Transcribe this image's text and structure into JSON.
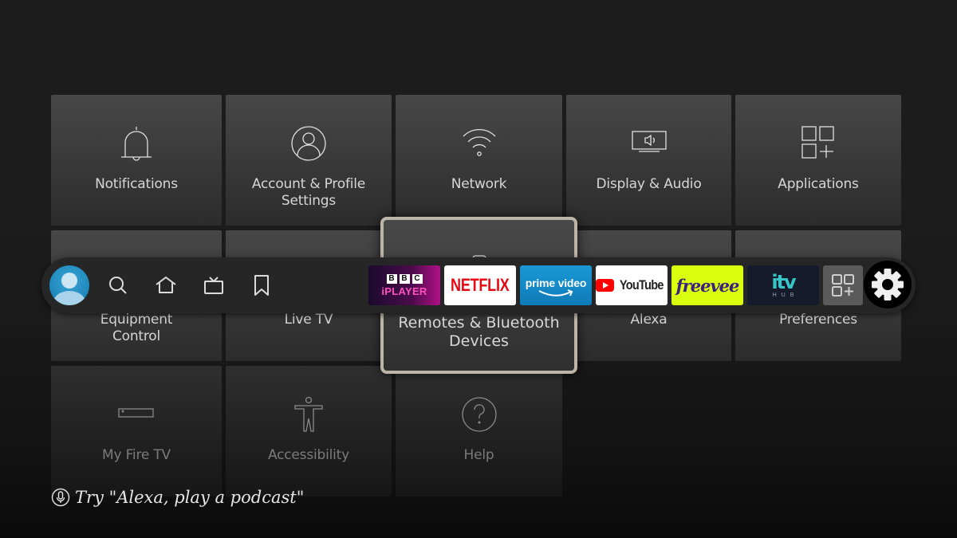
{
  "settings_grid": {
    "tiles": [
      {
        "label": "Notifications",
        "icon": "bell-icon"
      },
      {
        "label": "Account & Profile Settings",
        "icon": "profile-icon"
      },
      {
        "label": "Network",
        "icon": "wifi-icon"
      },
      {
        "label": "Display & Audio",
        "icon": "display-audio-icon"
      },
      {
        "label": "Applications",
        "icon": "applications-icon"
      },
      {
        "label": "Equipment Control",
        "icon": "equipment-icon"
      },
      {
        "label": "Live TV",
        "icon": "live-tv-icon"
      },
      {
        "label": "Remotes & Bluetooth Devices",
        "icon": "remote-icon",
        "focused": true
      },
      {
        "label": "Alexa",
        "icon": "alexa-icon"
      },
      {
        "label": "Preferences",
        "icon": "preferences-icon"
      },
      {
        "label": "My Fire TV",
        "icon": "fire-tv-stick-icon"
      },
      {
        "label": "Accessibility",
        "icon": "accessibility-icon"
      },
      {
        "label": "Help",
        "icon": "help-icon"
      }
    ]
  },
  "navbar": {
    "profile": "avatar",
    "nav_items": [
      {
        "name": "search",
        "icon": "search-icon"
      },
      {
        "name": "home",
        "icon": "home-icon"
      },
      {
        "name": "live",
        "icon": "tv-icon"
      },
      {
        "name": "watchlist",
        "icon": "bookmark-icon"
      }
    ],
    "apps": {
      "bbc": {
        "line1": [
          "B",
          "B",
          "C"
        ],
        "line2": "iPLAYER"
      },
      "netflix": "NETFLIX",
      "prime": "prime video",
      "youtube": "YouTube",
      "freevee": "freevee",
      "itv": {
        "logo": "itv",
        "sub": "HUB"
      },
      "more": "apps-grid-icon"
    },
    "settings": "gear-icon"
  },
  "hint": {
    "text": "Try \"Alexa, play a podcast\""
  },
  "colors": {
    "focus_border": "#bcb4a6",
    "netflix_red": "#e50914",
    "freevee_bg": "#d9ff0f",
    "prime_blue": "#1a98d5",
    "itv_teal": "#37c5c7"
  }
}
